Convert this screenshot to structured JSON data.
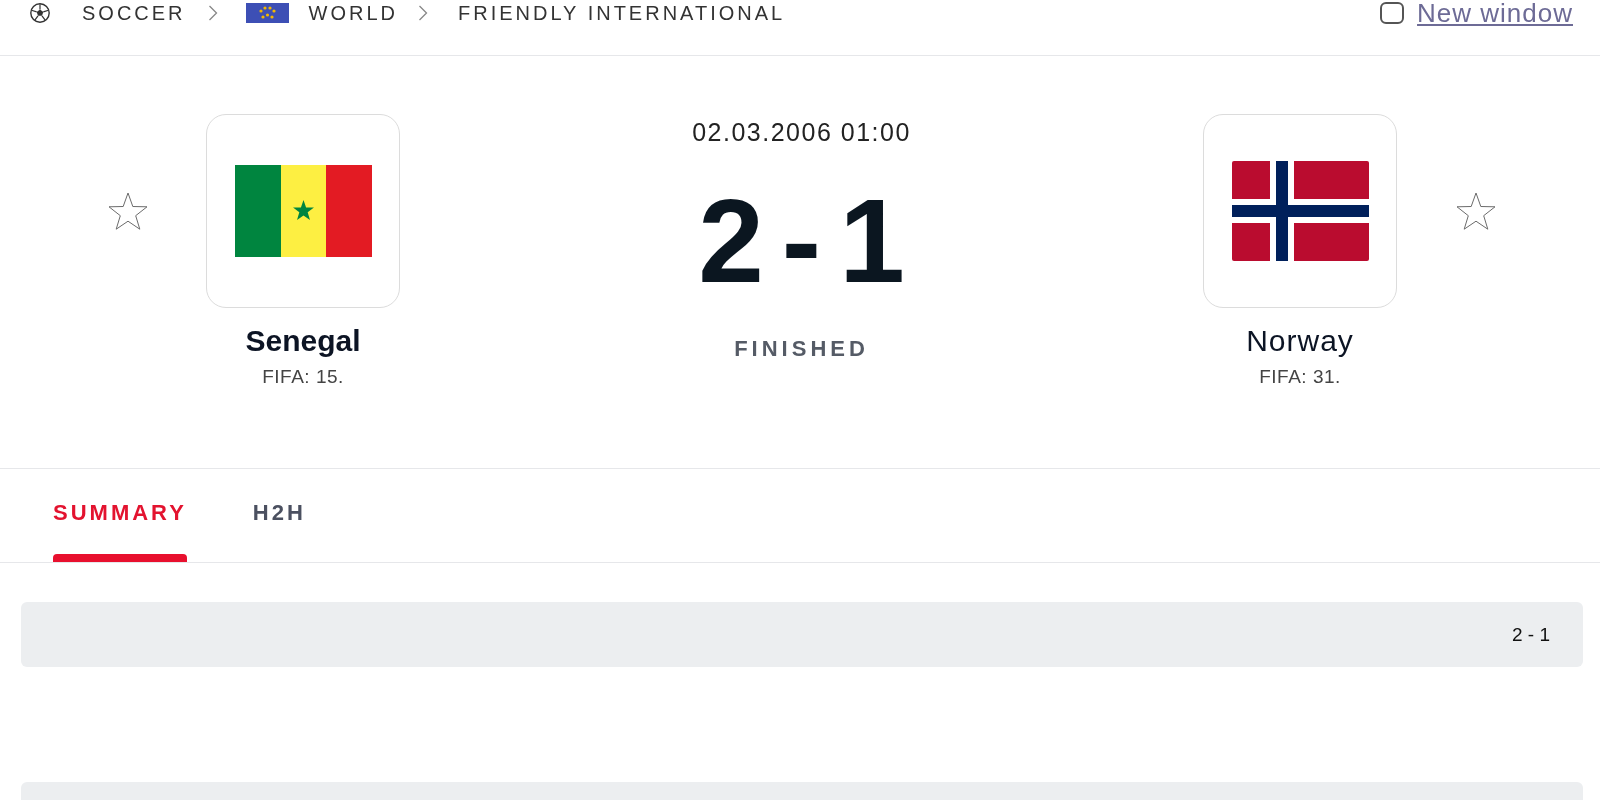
{
  "breadcrumb": [
    {
      "label": "SOCCER"
    },
    {
      "label": "WORLD"
    },
    {
      "label": "FRIENDLY INTERNATIONAL"
    }
  ],
  "new_window": {
    "label": "New window",
    "checked": false
  },
  "match": {
    "date": "02.03.2006 01:00",
    "score": "2-1",
    "status": "FINISHED",
    "teams": [
      {
        "name": "Senegal",
        "rank": "FIFA: 15.",
        "winner": true,
        "favorite": false
      },
      {
        "name": "Norway",
        "rank": "FIFA: 31.",
        "winner": false,
        "favorite": false
      }
    ]
  },
  "tabs": [
    {
      "label": "SUMMARY",
      "selected": true
    },
    {
      "label": "H2H",
      "selected": false
    }
  ],
  "summary": {
    "rows": [
      {
        "score": "2 - 1"
      }
    ]
  }
}
